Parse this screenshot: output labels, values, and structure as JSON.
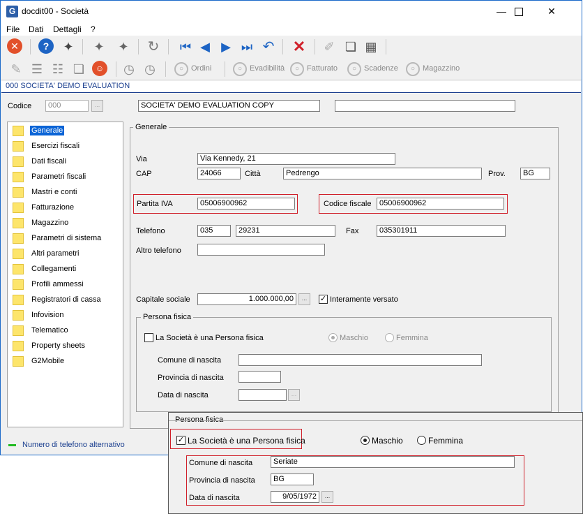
{
  "window": {
    "title": "docdit00 - Società",
    "app_icon": "G"
  },
  "menu": {
    "file": "File",
    "dati": "Dati",
    "dettagli": "Dettagli",
    "help": "?"
  },
  "toolbar2": {
    "ordini": "Ordini",
    "evadibilita": "Evadibilità",
    "fatturato": "Fatturato",
    "scadenze": "Scadenze",
    "magazzino": "Magazzino"
  },
  "banner": "000 SOCIETA' DEMO EVALUATION",
  "header": {
    "codice_label": "Codice",
    "codice_value": "000",
    "ragione_sociale": "SOCIETA' DEMO EVALUATION COPY",
    "descrizione2": ""
  },
  "tree": [
    "Generale",
    "Esercizi fiscali",
    "Dati fiscali",
    "Parametri fiscali",
    "Mastri e conti",
    "Fatturazione",
    "Magazzino",
    "Parametri di sistema",
    "Altri parametri",
    "Collegamenti",
    "Profili ammessi",
    "Registratori di cassa",
    "Infovision",
    "Telematico",
    "Property sheets",
    "G2Mobile"
  ],
  "form": {
    "group_title": "Generale",
    "via_label": "Via",
    "via_value": "Via Kennedy, 21",
    "cap_label": "CAP",
    "cap_value": "24066",
    "citta_label": "Città",
    "citta_value": "Pedrengo",
    "prov_label": "Prov.",
    "prov_value": "BG",
    "piva_label": "Partita IVA",
    "piva_value": "05006900962",
    "cf_label": "Codice fiscale",
    "cf_value": "05006900962",
    "tel_label": "Telefono",
    "tel_prefix": "035",
    "tel_number": "29231",
    "fax_label": "Fax",
    "fax_value": "035301911",
    "altro_tel_label": "Altro telefono",
    "altro_tel_value": "",
    "capitale_label": "Capitale sociale",
    "capitale_value": "1.000.000,00",
    "interamente_label": "Interamente versato"
  },
  "persona": {
    "group_title": "Persona fisica",
    "checkbox_label": "La Società è una Persona fisica",
    "maschio": "Maschio",
    "femmina": "Femmina",
    "comune_label": "Comune di nascita",
    "comune_value": "",
    "provincia_label": "Provincia di nascita",
    "provincia_value": "",
    "data_label": "Data di nascita",
    "data_value": ""
  },
  "status": {
    "text": "Numero di telefono alternativo",
    "color": "#22bb22"
  },
  "zoom": {
    "group_title": "Persona fisica",
    "checkbox_label": "La Società è una Persona fisica",
    "maschio": "Maschio",
    "femmina": "Femmina",
    "comune_label": "Comune di nascita",
    "comune_value": "Seriate",
    "provincia_label": "Provincia di nascita",
    "provincia_value": "BG",
    "data_label": "Data di nascita",
    "data_value": "9/05/1972"
  },
  "ellipsis": "..."
}
